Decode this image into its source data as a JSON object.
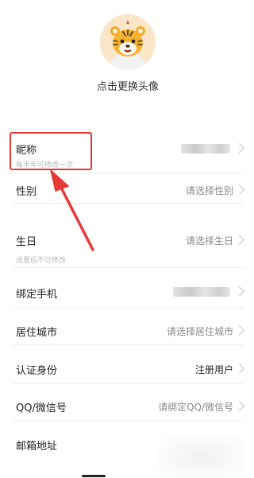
{
  "profile": {
    "change_avatar": "点击更换头像"
  },
  "rows": [
    {
      "label": "昵称",
      "hint": "每半年可修改一次",
      "value": "",
      "chevron": true
    },
    {
      "label": "性别",
      "value": "请选择性别"
    },
    {
      "label": "生日",
      "value": "请选择生日",
      "hint": "设置后不可修改"
    },
    {
      "label": "绑定手机",
      "value": ""
    },
    {
      "label": "居住城市",
      "value": "请选择居住城市"
    },
    {
      "label": "认证身份",
      "value": "注册用户"
    },
    {
      "label": "QQ/微信号",
      "value": "请绑定QQ/微信号"
    },
    {
      "label": "邮箱地址",
      "value": ""
    }
  ],
  "colors": {
    "highlight": "#e53935",
    "arrow": "#e53935"
  }
}
